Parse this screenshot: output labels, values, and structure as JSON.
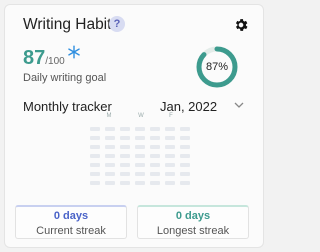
{
  "header": {
    "title": "Writing Habit",
    "help_icon": "?",
    "settings_icon": "gear-icon"
  },
  "goal": {
    "score": "87",
    "score_max": "/100",
    "label": "Daily writing goal",
    "bonus_icon": "snowflake-icon"
  },
  "progress": {
    "percent_label": "87%",
    "fraction": 0.87,
    "color": "#3d9b8e"
  },
  "tracker": {
    "title": "Monthly tracker",
    "month": "Jan, 2022",
    "dropdown_icon": "chevron-down-icon",
    "weekdays": [
      "M",
      "W",
      "F"
    ]
  },
  "streaks": {
    "current": {
      "value": "0 days",
      "label": "Current streak",
      "color": "#4a63c8"
    },
    "longest": {
      "value": "0 days",
      "label": "Longest streak",
      "color": "#3d9b8e"
    }
  }
}
